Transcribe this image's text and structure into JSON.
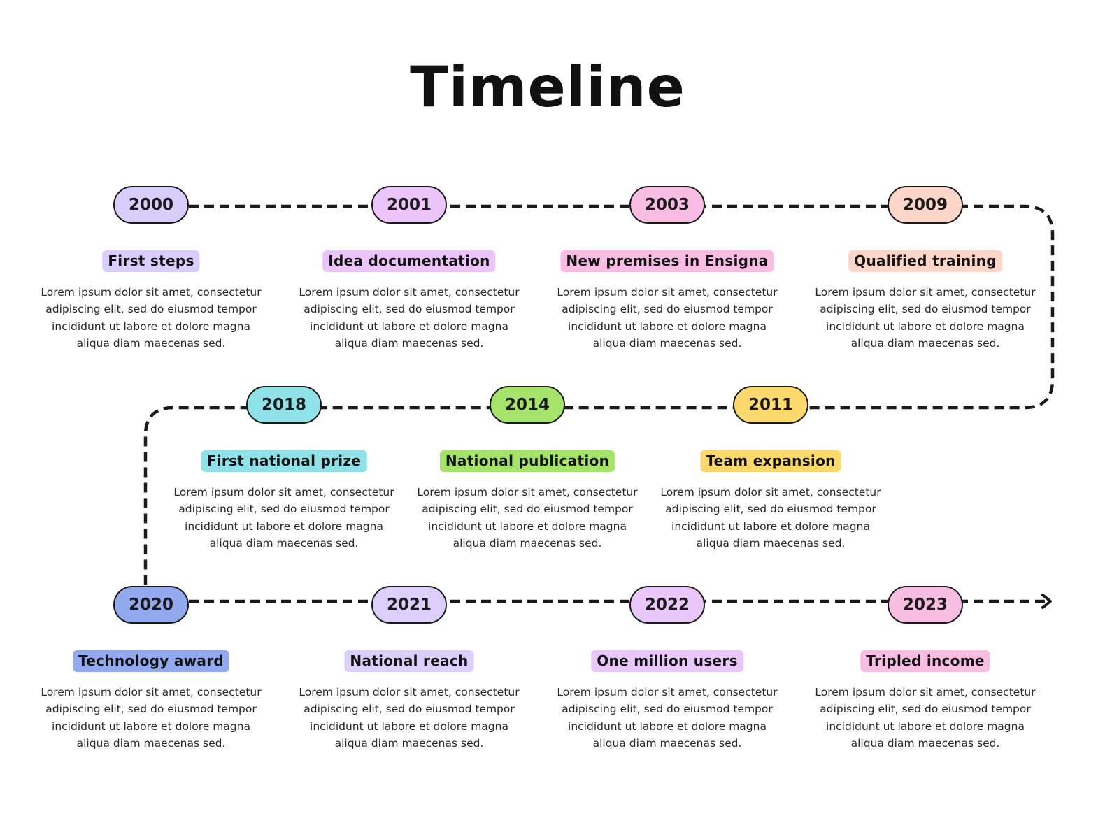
{
  "title": "Timeline",
  "body_text": "Lorem ipsum dolor sit amet, consectetur adipiscing elit, sed do eiusmod tempor incididunt ut labore et dolore magna aliqua diam maecenas sed.",
  "events": [
    {
      "year": "2000",
      "label": "First steps",
      "color": "#d9cdfb",
      "text": "Lorem ipsum dolor sit amet, consectetur adipiscing elit, sed do eiusmod tempor incididunt ut labore et dolore magna aliqua diam maecenas sed."
    },
    {
      "year": "2001",
      "label": "Idea documentation",
      "color": "#ebc5fa",
      "text": "Lorem ipsum dolor sit amet, consectetur adipiscing elit, sed do eiusmod tempor incididunt ut labore et dolore magna aliqua diam maecenas sed."
    },
    {
      "year": "2003",
      "label": "New premises in Ensigna",
      "color": "#f9bce3",
      "text": "Lorem ipsum dolor sit amet, consectetur adipiscing elit, sed do eiusmod tempor incididunt ut labore et dolore magna aliqua diam maecenas sed."
    },
    {
      "year": "2009",
      "label": "Qualified training",
      "color": "#fcd6c8",
      "text": "Lorem ipsum dolor sit amet, consectetur adipiscing elit, sed do eiusmod tempor incididunt ut labore et dolore magna aliqua diam maecenas sed."
    },
    {
      "year": "2011",
      "label": "Team expansion",
      "color": "#fcd96c",
      "text": "Lorem ipsum dolor sit amet, consectetur adipiscing elit, sed do eiusmod tempor incididunt ut labore et dolore magna aliqua diam maecenas sed."
    },
    {
      "year": "2014",
      "label": "National publication",
      "color": "#a6e36a",
      "text": "Lorem ipsum dolor sit amet, consectetur adipiscing elit, sed do eiusmod tempor incididunt ut labore et dolore magna aliqua diam maecenas sed."
    },
    {
      "year": "2018",
      "label": "First national prize",
      "color": "#8ee2e8",
      "text": "Lorem ipsum dolor sit amet, consectetur adipiscing elit, sed do eiusmod tempor incididunt ut labore et dolore magna aliqua diam maecenas sed."
    },
    {
      "year": "2020",
      "label": "Technology award",
      "color": "#93a9ee",
      "text": "Lorem ipsum dolor sit amet, consectetur adipiscing elit, sed do eiusmod tempor incididunt ut labore et dolore magna aliqua diam maecenas sed."
    },
    {
      "year": "2021",
      "label": "National reach",
      "color": "#dccffb",
      "text": "Lorem ipsum dolor sit amet, consectetur adipiscing elit, sed do eiusmod tempor incididunt ut labore et dolore magna aliqua diam maecenas sed."
    },
    {
      "year": "2022",
      "label": "One million users",
      "color": "#eac7fb",
      "text": "Lorem ipsum dolor sit amet, consectetur adipiscing elit, sed do eiusmod tempor incididunt ut labore et dolore magna aliqua diam maecenas sed."
    },
    {
      "year": "2023",
      "label": "Tripled income",
      "color": "#f8bde2",
      "text": "Lorem ipsum dolor sit amet, consectetur adipiscing elit, sed do eiusmod tempor incididunt ut labore et dolore magna aliqua diam maecenas sed."
    }
  ],
  "body_lines": [
    "Lorem ipsum dolor sit amet, consectetur",
    "adipiscing elit, sed do eiusmod tempor",
    "incididunt ut labore et dolore magna",
    "aliqua diam maecenas sed."
  ]
}
